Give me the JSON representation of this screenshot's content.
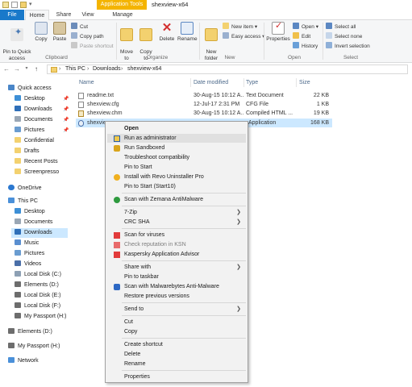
{
  "window": {
    "title": "shexview-x64",
    "context_tab": "Application Tools"
  },
  "tabs": [
    "File",
    "Home",
    "Share",
    "View",
    "Manage"
  ],
  "ribbon": {
    "clipboard": {
      "label": "Clipboard",
      "pin_quick_access": "Pin to Quick\naccess",
      "copy": "Copy",
      "paste": "Paste",
      "cut": "Cut",
      "copy_path": "Copy path",
      "paste_shortcut": "Paste shortcut"
    },
    "organize": {
      "label": "Organize",
      "move_to": "Move\nto",
      "copy_to": "Copy\nto",
      "delete": "Delete",
      "rename": "Rename"
    },
    "new": {
      "label": "New",
      "new_folder": "New\nfolder",
      "new_item": "New item",
      "easy_access": "Easy access"
    },
    "open": {
      "label": "Open",
      "properties": "Properties",
      "open": "Open",
      "edit": "Edit",
      "history": "History"
    },
    "select": {
      "label": "Select",
      "select_all": "Select all",
      "select_none": "Select none",
      "invert_selection": "Invert selection"
    }
  },
  "address": {
    "breadcrumbs": [
      "This PC",
      "Downloads",
      "shexview-x64"
    ]
  },
  "nav": {
    "quick_access": "Quick access",
    "qa_items": [
      "Desktop",
      "Downloads",
      "Documents",
      "Pictures",
      "Confidential",
      "Drafts",
      "Recent Posts",
      "Screenpresso"
    ],
    "onedrive": "OneDrive",
    "this_pc": "This PC",
    "pc_items": [
      "Desktop",
      "Documents",
      "Downloads",
      "Music",
      "Pictures",
      "Videos",
      "Local Disk (C:)",
      "Elements (D:)",
      "Local Disk (E:)",
      "Local Disk (F:)",
      "My Passport (H:)"
    ],
    "elements": "Elements (D:)",
    "my_passport": "My Passport (H:)",
    "network": "Network"
  },
  "files": {
    "columns": [
      "Name",
      "Date modified",
      "Type",
      "Size"
    ],
    "rows": [
      {
        "name": "readme.txt",
        "date": "30-Aug-15 10:12 A...",
        "type": "Text Document",
        "size": "22 KB"
      },
      {
        "name": "shexview.cfg",
        "date": "12-Jul-17 2:31 PM",
        "type": "CFG File",
        "size": "1 KB"
      },
      {
        "name": "shexview.chm",
        "date": "30-Aug-15 10:12 A...",
        "type": "Compiled HTML ...",
        "size": "19 KB"
      },
      {
        "name": "shexview",
        "date": "",
        "type": "Application",
        "size": "168 KB"
      }
    ]
  },
  "context_menu": {
    "items": [
      "Open",
      "Run as administrator",
      "Run Sandboxed",
      "Troubleshoot compatibility",
      "Pin to Start",
      "Install with Revo Uninstaller Pro",
      "Pin to Start (Start10)",
      "Scan with Zemana AntiMalware",
      "7-Zip",
      "CRC SHA",
      "Scan for viruses",
      "Check reputation in KSN",
      "Kaspersky Application Advisor",
      "Share with",
      "Pin to taskbar",
      "Scan with Malwarebytes Anti-Malware",
      "Restore previous versions",
      "Send to",
      "Cut",
      "Copy",
      "Create shortcut",
      "Delete",
      "Rename",
      "Properties"
    ]
  },
  "colors": {
    "file_tab": "#1979ca",
    "context_tab": "#f4b400",
    "selection": "#cce8ff",
    "menu_bg": "#f2f2f2"
  }
}
